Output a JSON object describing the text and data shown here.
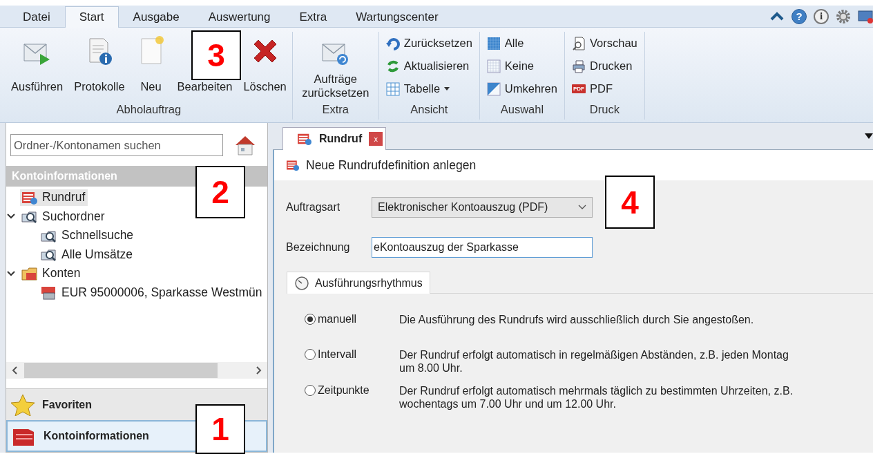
{
  "menu_tabs": [
    {
      "label": "Datei",
      "selected": false
    },
    {
      "label": "Start",
      "selected": true
    },
    {
      "label": "Ausgabe",
      "selected": false
    },
    {
      "label": "Auswertung",
      "selected": false
    },
    {
      "label": "Extra",
      "selected": false
    },
    {
      "label": "Wartungscenter",
      "selected": false
    }
  ],
  "title_controls": [
    {
      "kind": "collapse"
    },
    {
      "kind": "help",
      "glyph": "?"
    },
    {
      "kind": "info",
      "glyph": "i"
    },
    {
      "kind": "settings"
    },
    {
      "kind": "window"
    }
  ],
  "ribbon_groups": [
    {
      "label": "Abholauftrag",
      "kind": "large",
      "items": [
        {
          "label": "Ausführen"
        },
        {
          "label": "Protokolle"
        },
        {
          "label": "Neu"
        },
        {
          "label": "Bearbeiten"
        },
        {
          "label": "Löschen"
        }
      ]
    },
    {
      "label": "Extra",
      "kind": "large",
      "items": [
        {
          "label": "Aufträge zurücksetzen"
        }
      ]
    },
    {
      "label": "Ansicht",
      "kind": "small",
      "items": [
        {
          "label": "Zurücksetzen"
        },
        {
          "label": "Aktualisieren"
        },
        {
          "label": "Tabelle",
          "dropdown": true
        }
      ]
    },
    {
      "label": "Auswahl",
      "kind": "small",
      "items": [
        {
          "label": "Alle"
        },
        {
          "label": "Keine"
        },
        {
          "label": "Umkehren"
        }
      ]
    },
    {
      "label": "Druck",
      "kind": "small",
      "items": [
        {
          "label": "Vorschau"
        },
        {
          "label": "Drucken"
        },
        {
          "label": "PDF",
          "badge": "PDF"
        }
      ]
    }
  ],
  "sidebar": {
    "search": {
      "placeholder": "Ordner-/Kontonamen suchen"
    },
    "header": "Kontoinformationen",
    "tree": [
      {
        "label": "Rundruf",
        "selected": true
      },
      {
        "label": "Suchordner",
        "selected": false,
        "expanded": true,
        "children": [
          {
            "label": "Schnellsuche",
            "selected": false
          },
          {
            "label": "Alle Umsätze",
            "selected": false
          }
        ]
      },
      {
        "label": "Konten",
        "selected": false,
        "expanded": true,
        "children": [
          {
            "label": "EUR 95000006, Sparkasse Westmün",
            "selected": false
          }
        ]
      }
    ],
    "nav_buttons": [
      {
        "label": "Favoriten",
        "selected": false
      },
      {
        "label": "Kontoinformationen",
        "selected": true
      }
    ]
  },
  "document_tabs": [
    {
      "label": "Rundruf",
      "close": "x",
      "selected": true
    }
  ],
  "form": {
    "title": "Neue Rundrufdefinition anlegen",
    "fields": [
      {
        "kind": "dropdown",
        "label": "Auftragsart",
        "value": "Elektronischer Kontoauszug (PDF)"
      },
      {
        "kind": "text",
        "label": "Bezeichnung",
        "value": "eKontoauszug der Sparkasse"
      }
    ],
    "tabs": [
      {
        "label": "Ausführungsrhythmus",
        "selected": true
      }
    ],
    "options": [
      {
        "label": "manuell",
        "description": "Die Ausführung des Rundrufs wird ausschließlich durch Sie angestoßen.",
        "selected": true
      },
      {
        "label": "Intervall",
        "description": "Der Rundruf erfolgt automatisch in regelmäßigen Abständen, z.B. jeden Montag um 8.00 Uhr.",
        "selected": false
      },
      {
        "label": "Zeitpunkte",
        "description": "Der Rundruf erfolgt automatisch mehrmals täglich zu bestimmten Uhrzeiten, z.B. wochentags um 7.00 Uhr und um 12.00 Uhr.",
        "selected": false
      }
    ]
  },
  "callouts": [
    {
      "label": "3"
    },
    {
      "label": "2"
    },
    {
      "label": "4"
    },
    {
      "label": "1"
    }
  ]
}
